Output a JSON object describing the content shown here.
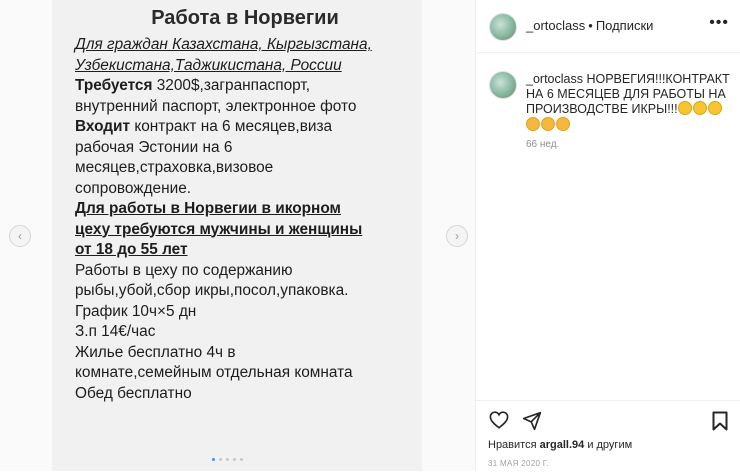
{
  "post_image": {
    "title": "Работа в Норвегии",
    "lines": [
      {
        "segments": [
          {
            "text": "Для граждан Казахстана, Кыргызстана,",
            "style": "u-italic"
          }
        ]
      },
      {
        "segments": [
          {
            "text": "Узбекистана,Таджикистана, России",
            "style": "u-italic"
          }
        ]
      },
      {
        "segments": [
          {
            "text": "Требуется",
            "style": "b"
          },
          {
            "text": " 3200$,загранпаспорт,",
            "style": ""
          }
        ]
      },
      {
        "segments": [
          {
            "text": "внутренний паспорт, электронное фото",
            "style": ""
          }
        ]
      },
      {
        "segments": [
          {
            "text": "Входит",
            "style": "b"
          },
          {
            "text": " контракт на 6 месяцев,виза",
            "style": ""
          }
        ]
      },
      {
        "segments": [
          {
            "text": "рабочая Эстонии на 6",
            "style": ""
          }
        ]
      },
      {
        "segments": [
          {
            "text": "месяцев,страховка,визовое",
            "style": ""
          }
        ]
      },
      {
        "segments": [
          {
            "text": "сопровождение.",
            "style": ""
          }
        ]
      },
      {
        "segments": [
          {
            "text": "Для работы в Норвегии в икорном",
            "style": "u-bold"
          }
        ]
      },
      {
        "segments": [
          {
            "text": "цеху требуются мужчины и женщины",
            "style": "u-bold"
          }
        ]
      },
      {
        "segments": [
          {
            "text": "от 18 до 55 лет",
            "style": "u-bold"
          }
        ]
      },
      {
        "segments": [
          {
            "text": "Работы в цеху по содержанию",
            "style": ""
          }
        ]
      },
      {
        "segments": [
          {
            "text": "рыбы,убой,сбор икры,посол,упаковка.",
            "style": ""
          }
        ]
      },
      {
        "segments": [
          {
            "text": "График 10ч×5 дн",
            "style": ""
          }
        ]
      },
      {
        "segments": [
          {
            "text": "З.п 14€/час",
            "style": ""
          }
        ]
      },
      {
        "segments": [
          {
            "text": "Жилье бесплатно 4ч в",
            "style": ""
          }
        ]
      },
      {
        "segments": [
          {
            "text": "комнате,семейным отдельная комната",
            "style": ""
          }
        ]
      },
      {
        "segments": [
          {
            "text": "Обед бесплатно",
            "style": ""
          }
        ]
      }
    ]
  },
  "carousel": {
    "prev_icon": "‹",
    "next_icon": "›",
    "dot_count": 5,
    "active_dot": 0
  },
  "header": {
    "username": "_ortoclass",
    "separator": "•",
    "follow_label": "Подписки",
    "more_icon": "•••"
  },
  "caption": {
    "username": "_ortoclass",
    "text": "НОРВЕГИЯ!!!КОНТРАКТ НА 6 МЕСЯЦЕВ ДЛЯ РАБОТЫ НА ПРОИЗВОДСТВЕ ИКРЫ!!!",
    "emojis": [
      "face-savoring-emoji",
      "face-savoring-emoji",
      "face-savoring-emoji",
      "astonished-face-emoji",
      "astonished-face-emoji",
      "astonished-face-emoji"
    ],
    "time_ago": "66 нед."
  },
  "footer": {
    "likes_prefix": "Нравится",
    "liked_by": "argall.94",
    "likes_suffix": "и другим",
    "date": "31 МАЯ 2020 Г."
  },
  "colors": {
    "accent_blue": "#3897f0",
    "text": "#262626",
    "muted": "#8e8e8e"
  }
}
